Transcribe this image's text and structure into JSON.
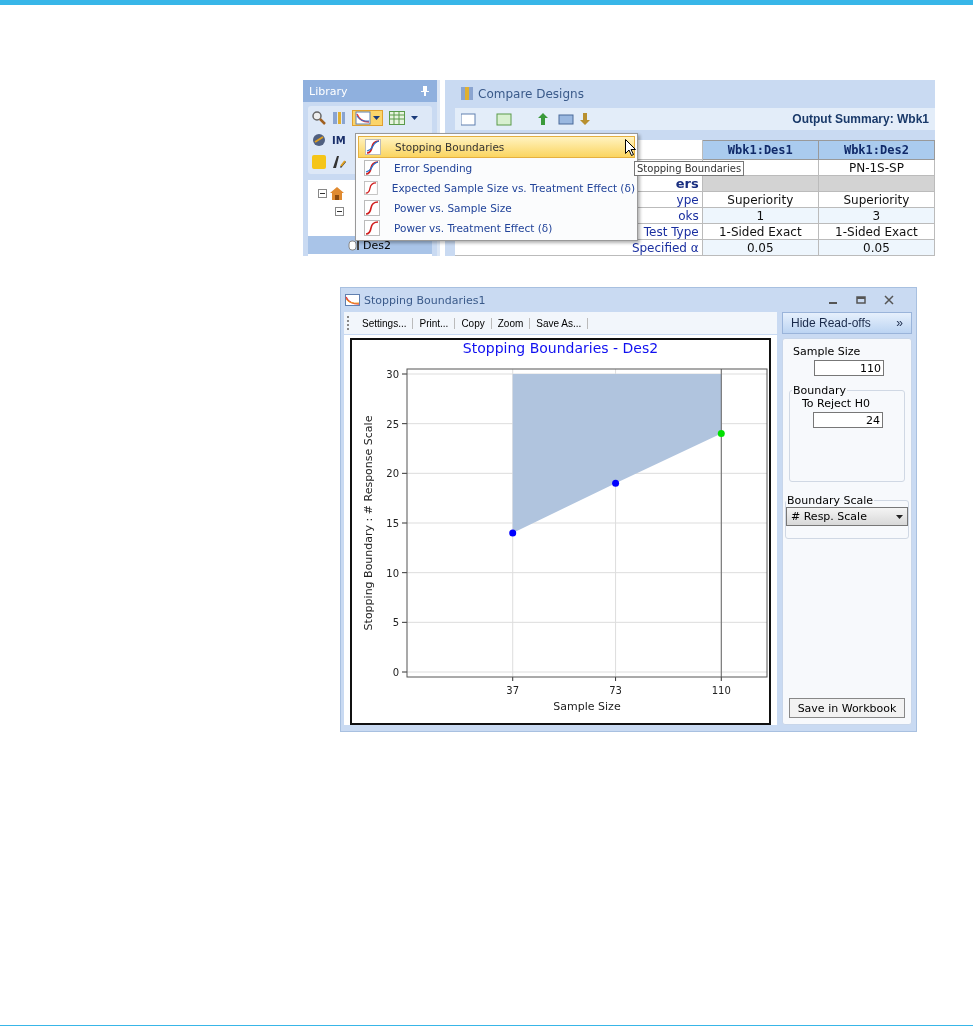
{
  "library": {
    "title": "Library",
    "toolbar_text": "IM",
    "tree_items": [
      {
        "label": "Des2",
        "selected": true
      }
    ]
  },
  "menu": {
    "items": [
      {
        "label": "Stopping Boundaries",
        "selected": true
      },
      {
        "label": "Error Spending",
        "selected": false
      },
      {
        "label": "Expected Sample Size vs. Treatment Effect (δ)",
        "selected": false
      },
      {
        "label": "Power vs. Sample Size",
        "selected": false
      },
      {
        "label": "Power vs. Treatment Effect (δ)",
        "selected": false
      }
    ],
    "tooltip": "Stopping Boundaries"
  },
  "compare_window": {
    "title": "Compare Designs",
    "summary_title": "Output Summary: Wbk1",
    "table": {
      "columns": [
        "Wbk1:Des1",
        "Wbk1:Des2"
      ],
      "rows": [
        {
          "kind": "data",
          "label": null,
          "cells": [
            null,
            "PN-1S-SP"
          ]
        },
        {
          "kind": "section",
          "label": "ers",
          "cells": [
            null,
            null
          ]
        },
        {
          "kind": "data",
          "label": "ype",
          "cells": [
            "Superiority",
            "Superiority"
          ]
        },
        {
          "kind": "data",
          "label": "oks",
          "cells": [
            "1",
            "3"
          ]
        },
        {
          "kind": "data",
          "label": "Test Type",
          "cells": [
            "1-Sided Exact",
            "1-Sided Exact"
          ]
        },
        {
          "kind": "data",
          "label": "Specified α",
          "cells": [
            "0.05",
            "0.05"
          ]
        }
      ]
    }
  },
  "plot_window": {
    "title": "Stopping Boundaries1",
    "toolbar": [
      "Settings...",
      "Print...",
      "Copy",
      "Zoom",
      "Save As..."
    ],
    "chart": {
      "chart_data": {
        "type": "scatter",
        "title": "Stopping Boundaries - Des2",
        "xlabel": "Sample Size",
        "ylabel": "Stopping Boundary : # Response Scale",
        "x": [
          37,
          73,
          110
        ],
        "series": [
          {
            "color": "#0000ff",
            "values": [
              14,
              19,
              null
            ]
          },
          {
            "color": "#00e000",
            "values": [
              null,
              null,
              24
            ]
          }
        ],
        "grid": true,
        "ref_lines": [
          {
            "axis": "x",
            "value": 110
          }
        ],
        "xlim": [
          0,
          126
        ],
        "ylim": [
          0,
          30
        ],
        "xticks": [
          37,
          73,
          110
        ],
        "yticks": [
          0,
          5,
          10,
          15,
          20,
          25,
          30
        ]
      }
    },
    "readoffs": {
      "hide_button": "Hide Read-offs",
      "hide_arrow": "»",
      "sample_size_label": "Sample Size",
      "sample_size_value": "110",
      "boundary_group": "Boundary",
      "reject_label": "To Reject H0",
      "reject_value": "24",
      "scale_group": "Boundary Scale",
      "scale_value": "# Resp. Scale",
      "save_button": "Save in Workbook"
    }
  }
}
